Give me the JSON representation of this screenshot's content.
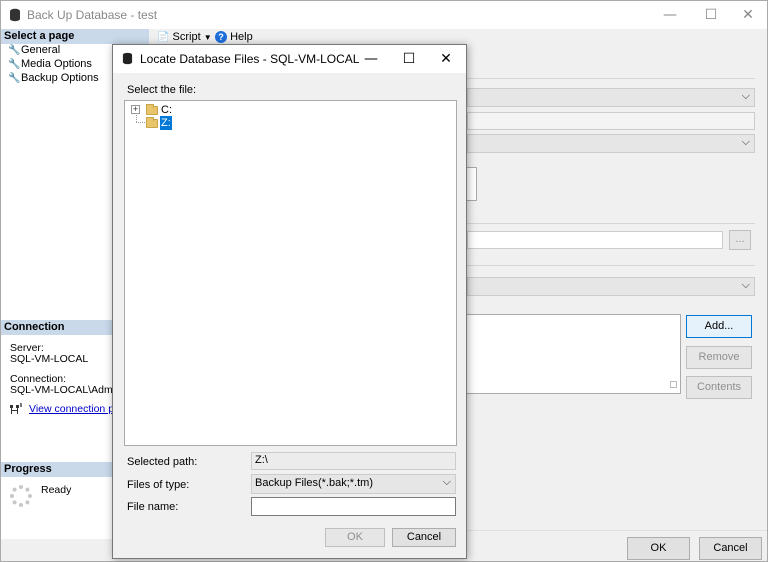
{
  "main_window": {
    "title": "Back Up Database - test",
    "controls": {
      "minimize": "—",
      "maximize": "☐",
      "close": "✕"
    }
  },
  "left_pane": {
    "select_page_header": "Select a page",
    "pages": [
      {
        "label": "General"
      },
      {
        "label": "Media Options"
      },
      {
        "label": "Backup Options"
      }
    ],
    "connection_header": "Connection",
    "server_label": "Server:",
    "server_value": "SQL-VM-LOCAL",
    "connection_label": "Connection:",
    "connection_value": "SQL-VM-LOCAL\\Administ",
    "view_connection_link": "View connection prop",
    "progress_header": "Progress",
    "progress_status": "Ready"
  },
  "toolbar": {
    "script_label": "Script",
    "help_label": "Help"
  },
  "right_pane": {
    "browse_button": "...",
    "add_button": "Add...",
    "remove_button": "Remove",
    "contents_button": "Contents",
    "ok_button": "OK",
    "cancel_button": "Cancel"
  },
  "dialog": {
    "title": "Locate Database Files - SQL-VM-LOCAL",
    "controls": {
      "minimize": "—",
      "maximize": "☐",
      "close": "✕"
    },
    "select_file_label": "Select the file:",
    "tree": [
      {
        "label": "C:",
        "expandable": true,
        "selected": false
      },
      {
        "label": "Z:",
        "expandable": false,
        "selected": true
      }
    ],
    "selected_path_label": "Selected path:",
    "selected_path_value": "Z:\\",
    "files_of_type_label": "Files of type:",
    "files_of_type_value": "Backup Files(*.bak;*.tm)",
    "file_name_label": "File name:",
    "file_name_value": "",
    "ok_button": "OK",
    "cancel_button": "Cancel"
  },
  "colors": {
    "section_header": "#c9d9ea",
    "selection": "#0078d7",
    "link": "#0000cc",
    "folder": "#e8c56b"
  }
}
